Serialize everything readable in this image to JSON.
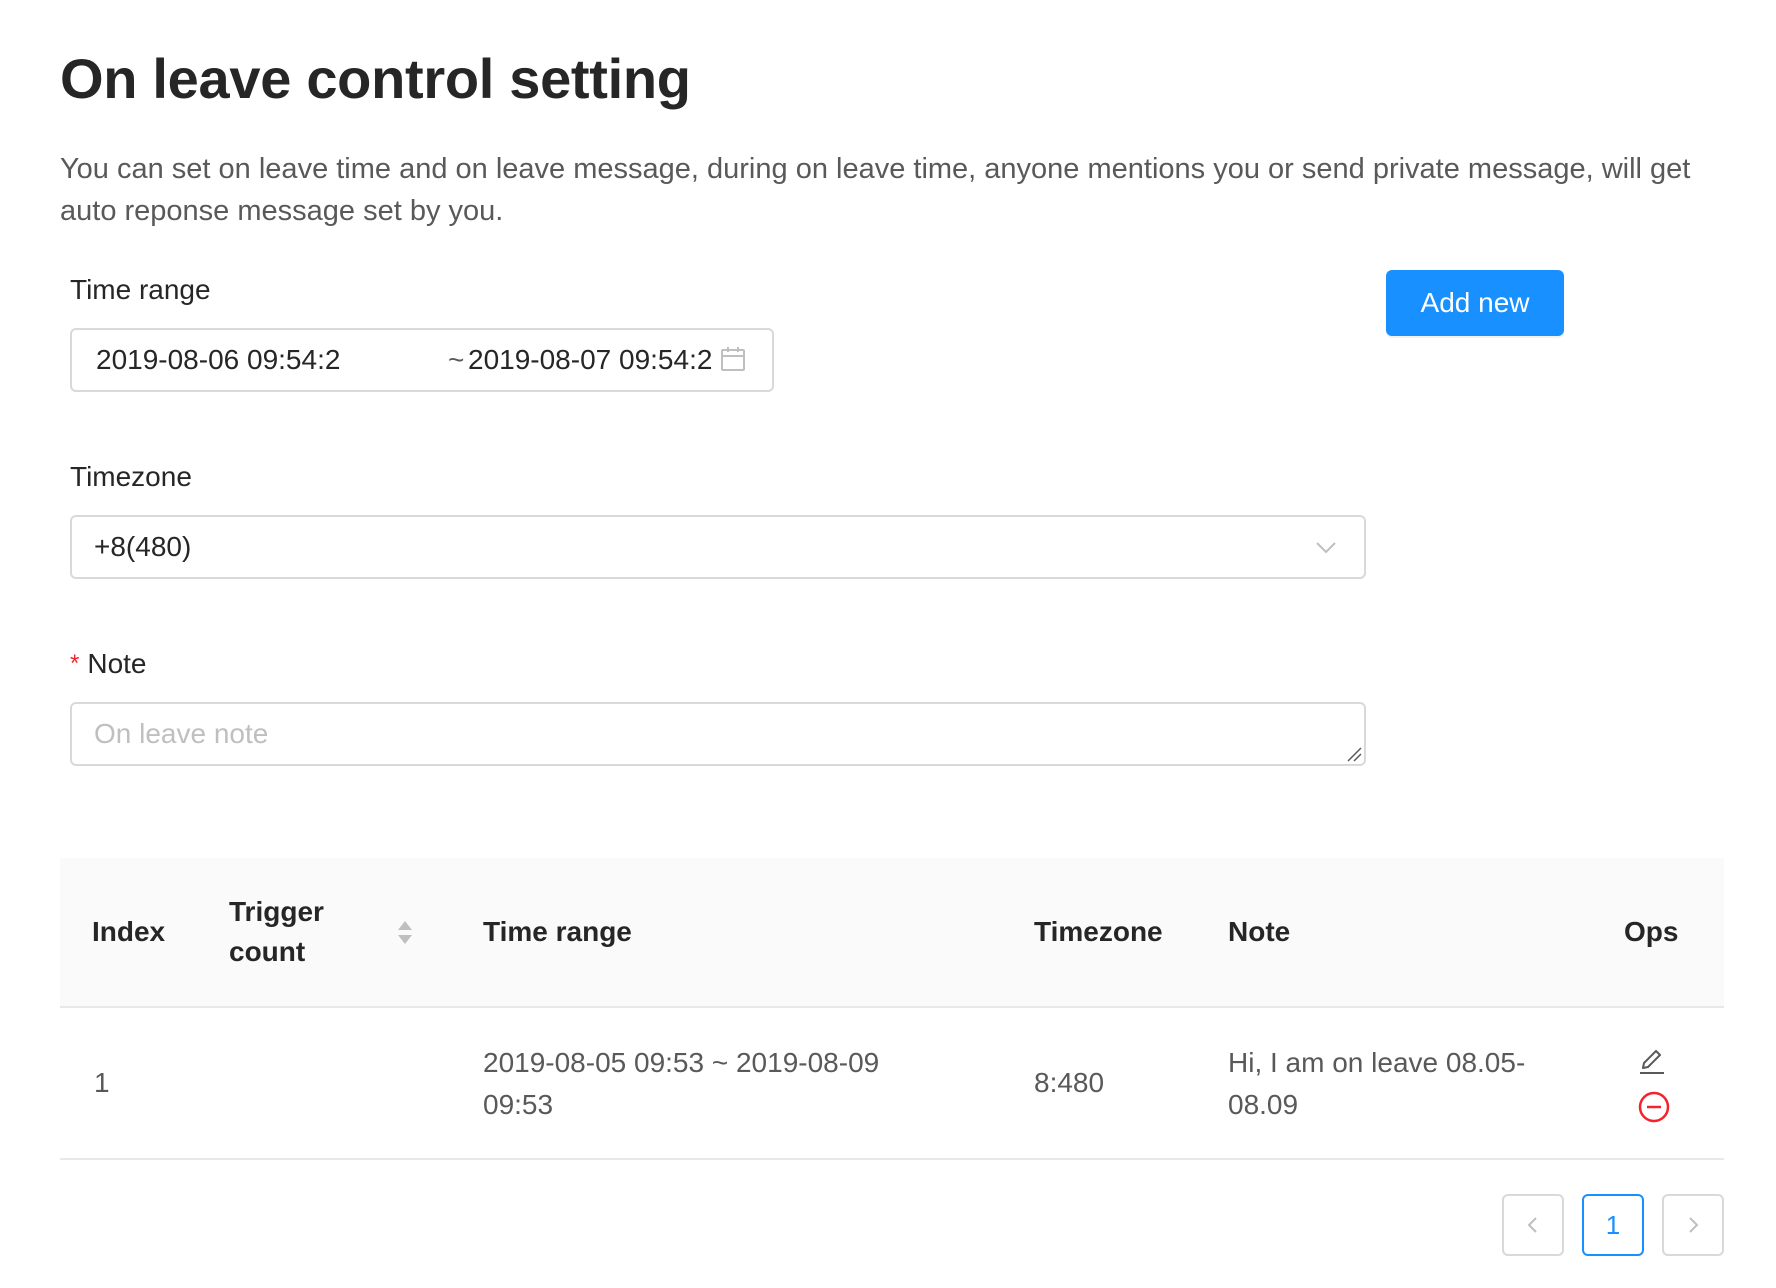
{
  "header": {
    "title": "On leave control setting",
    "description": "You can set on leave time and on leave message, during on leave time, anyone mentions you or send private message, will get auto reponse message set by you."
  },
  "form": {
    "time_range": {
      "label": "Time range",
      "start": "2019-08-06 09:54:2",
      "separator": "~",
      "end": "2019-08-07 09:54:2",
      "icon": "calendar-icon"
    },
    "timezone": {
      "label": "Timezone",
      "value": "+8(480)",
      "icon": "chevron-down-icon"
    },
    "note": {
      "label": "Note",
      "required_mark": "*",
      "placeholder": "On leave note"
    },
    "add_button_label": "Add new"
  },
  "table": {
    "columns": {
      "index": "Index",
      "trigger_count": "Trigger count",
      "time_range": "Time range",
      "timezone": "Timezone",
      "note": "Note",
      "ops": "Ops"
    },
    "rows": [
      {
        "index": "1",
        "trigger_count": "",
        "time_range": "2019-08-05 09:53 ~ 2019-08-09 09:53",
        "timezone": "8:480",
        "note": "Hi, I am on leave 08.05-08.09",
        "ops": [
          "edit-icon",
          "delete-icon"
        ]
      }
    ]
  },
  "pagination": {
    "prev_icon": "chevron-left-icon",
    "current_page": "1",
    "next_icon": "chevron-right-icon"
  },
  "colors": {
    "primary": "#1890ff",
    "danger": "#f5222d",
    "border": "#d9d9d9",
    "table_header_bg": "#fafafa"
  }
}
